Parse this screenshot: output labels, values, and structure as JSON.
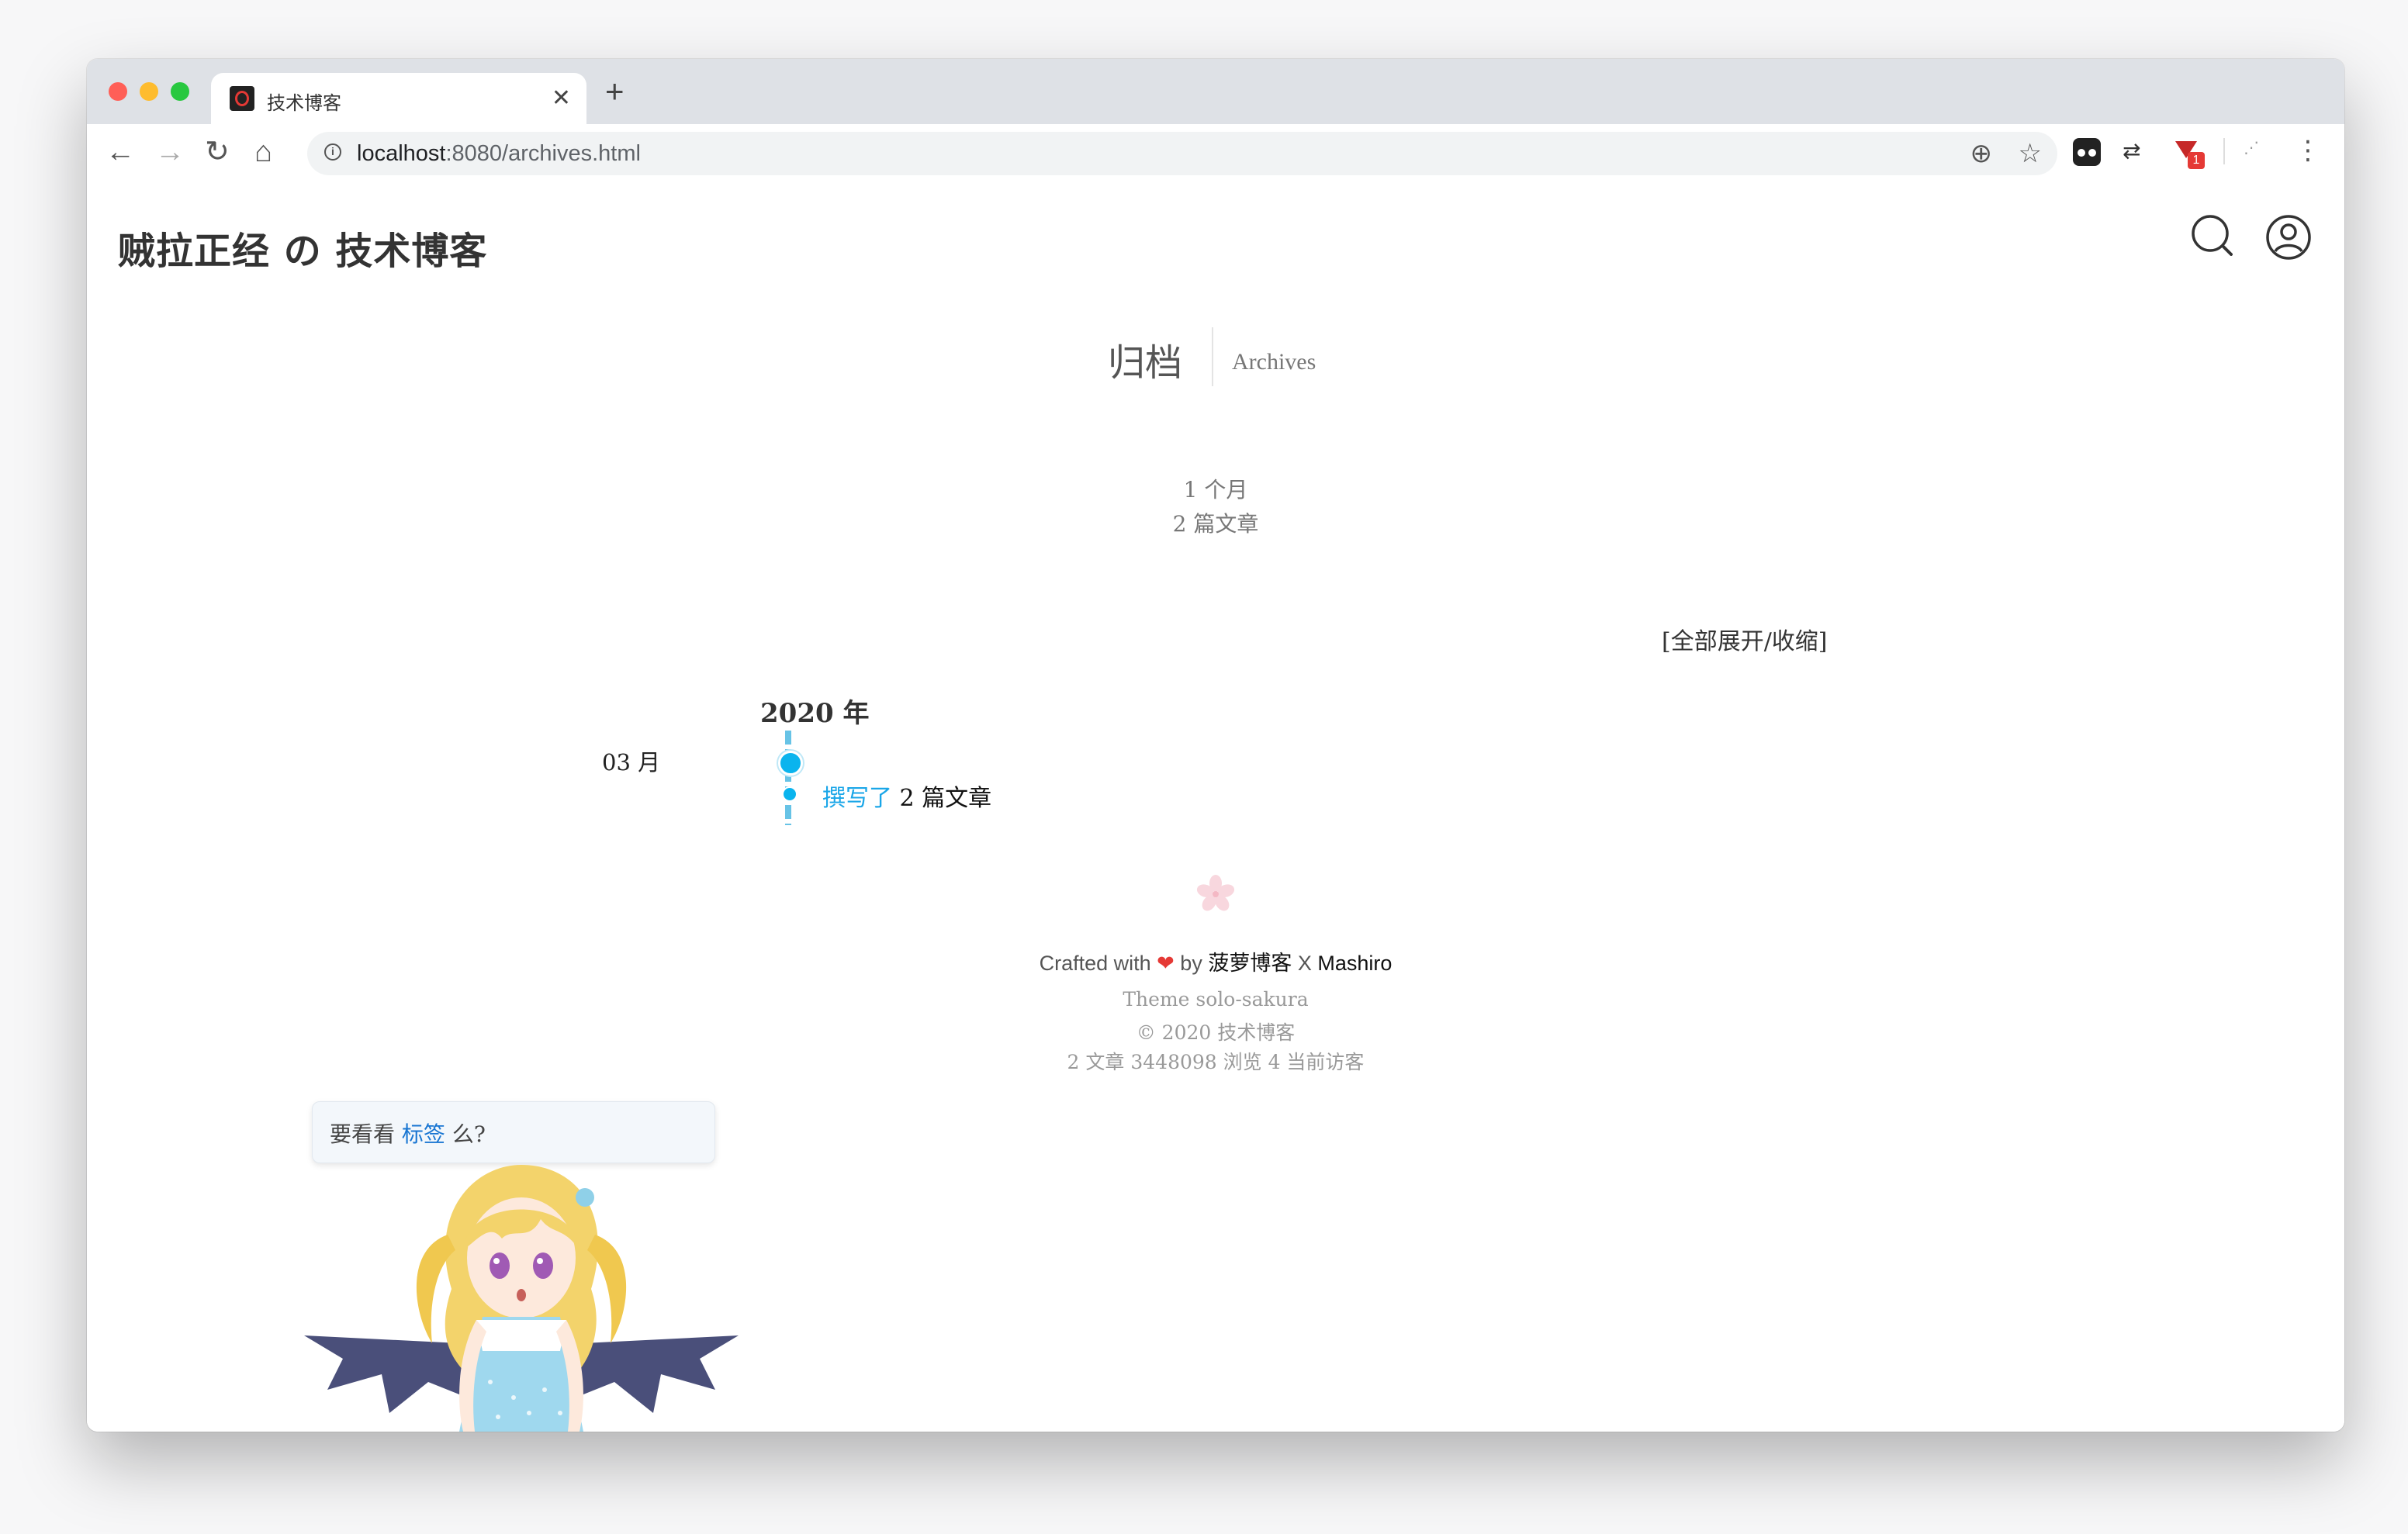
{
  "browser": {
    "tab_title": "技术博客",
    "tab_close": "✕",
    "new_tab": "+",
    "url_host": "localhost",
    "url_path": ":8080/archives.html",
    "ext_badge": "1",
    "menu": "⋮"
  },
  "site": {
    "title": "贼拉正经 の 技术博客"
  },
  "archive": {
    "title_cn": "归档",
    "title_en": "Archives",
    "months_total": "1 个月",
    "posts_total": "2 篇文章",
    "toggle_all": "[全部展开/收缩]",
    "year": "2020 年",
    "month": "03 月",
    "post_link": "撰写了",
    "post_count": "2 篇文章"
  },
  "footer": {
    "crafted_prefix": "Crafted with",
    "crafted_by": "by",
    "author": "菠萝博客",
    "x": "X",
    "partner": "Mashiro",
    "theme": "Theme solo-sakura",
    "copyright": "© 2020 技术博客",
    "stats": "2 文章   3448098 浏览   4 当前访客"
  },
  "mascot": {
    "bubble_prefix": "要看看",
    "bubble_link": "标签",
    "bubble_suffix": "么?"
  },
  "colors": {
    "accent": "#0ab4ee",
    "timeline": "#67c3e6",
    "heart": "#e53935"
  }
}
